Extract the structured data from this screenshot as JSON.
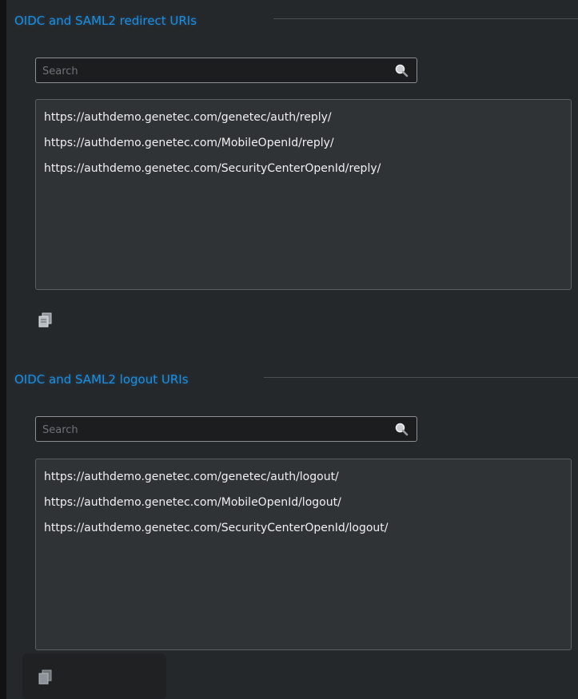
{
  "redirect": {
    "title": "OIDC and SAML2 redirect URIs",
    "search_placeholder": "Search",
    "uris": [
      "https://authdemo.genetec.com/genetec/auth/reply/",
      "https://authdemo.genetec.com/MobileOpenId/reply/",
      "https://authdemo.genetec.com/SecurityCenterOpenId/reply/"
    ],
    "action_icon": "copy-icon"
  },
  "logout": {
    "title": "OIDC and SAML2 logout URIs",
    "search_placeholder": "Search",
    "uris": [
      "https://authdemo.genetec.com/genetec/auth/logout/",
      "https://authdemo.genetec.com/MobileOpenId/logout/",
      "https://authdemo.genetec.com/SecurityCenterOpenId/logout/"
    ],
    "action_icon": "copy-icon"
  },
  "colors": {
    "accent": "#1e8fe0",
    "panel": "#25282b",
    "list_bg": "#303336"
  }
}
